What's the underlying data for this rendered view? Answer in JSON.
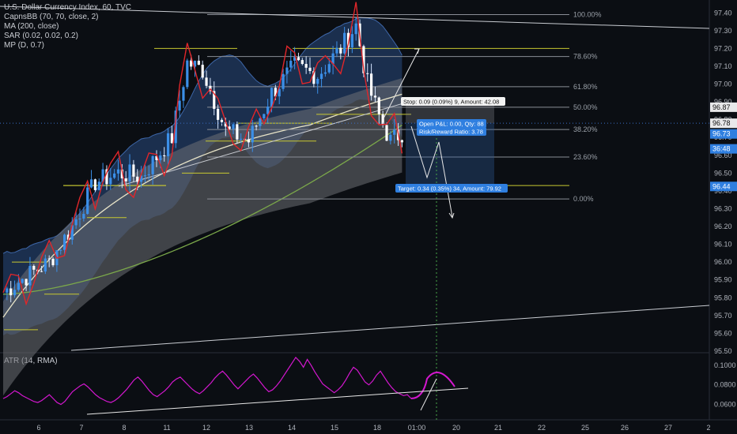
{
  "legend": {
    "title": "U.S. Dollar Currency Index, 60, TVC",
    "indicators": [
      "CapnsBB (70, 70, close, 2)",
      "MA (200, close)",
      "SAR (0.02, 0.02, 0.2)",
      "MP (D, 0.7)"
    ]
  },
  "atr_label": "ATR (14, RMA)",
  "colors": {
    "background": "#0b0e13",
    "band_blue": "#2a4a80",
    "band_grey": "#6d6f74",
    "sar_red": "#e0262a",
    "ma_green": "#7ba84a",
    "atr_magenta": "#d417cf",
    "fib_grey": "#8a8e96",
    "mp_yellow": "#c8c830",
    "price_tag_blue": "#2f7fe0"
  },
  "chart_data": {
    "type": "candlestick",
    "x_ticks": [
      "6",
      "7",
      "8",
      "11",
      "12",
      "13",
      "14",
      "15",
      "18",
      "01:00",
      "20",
      "21",
      "22",
      "25",
      "26",
      "27",
      "2"
    ],
    "y_ticks": [
      "97.40",
      "97.30",
      "97.20",
      "97.10",
      "97.00",
      "96.90",
      "96.80",
      "96.70",
      "96.60",
      "96.50",
      "96.40",
      "96.30",
      "96.20",
      "96.10",
      "96.00",
      "95.90",
      "95.80",
      "95.70",
      "95.60",
      "95.50"
    ],
    "ylim": [
      95.5,
      97.45
    ],
    "fib_levels": [
      {
        "label": "100.00%",
        "price": 97.39
      },
      {
        "label": "78.60%",
        "price": 97.155
      },
      {
        "label": "61.80%",
        "price": 96.985
      },
      {
        "label": "50.00%",
        "price": 96.87
      },
      {
        "label": "38.20%",
        "price": 96.745
      },
      {
        "label": "23.60%",
        "price": 96.59
      },
      {
        "label": "0.00%",
        "price": 96.355
      }
    ],
    "price_tags": [
      {
        "value": "96.87",
        "style": "light"
      },
      {
        "value": "96.78",
        "style": "light"
      },
      {
        "value": "96.73",
        "style": "blue"
      },
      {
        "value": "36:48",
        "style": "blue"
      },
      {
        "value": "96.44",
        "style": "blue"
      }
    ],
    "position_labels": {
      "stop": "Stop: 0.09 (0.09%) 9, Amount: 42.08",
      "open": "Open P&L: 0.00, Qty: 88",
      "ratio": "Risk/Reward Ratio: 3.78",
      "target": "Target: 0.34 (0.35%) 34, Amount: 79.92"
    },
    "atr_ticks": [
      "0.1000",
      "0.0800",
      "0.0600"
    ],
    "atr_ylim": [
      0.05,
      0.112
    ],
    "atr_values": [
      0.066,
      0.068,
      0.071,
      0.074,
      0.072,
      0.069,
      0.067,
      0.065,
      0.063,
      0.062,
      0.064,
      0.067,
      0.07,
      0.066,
      0.062,
      0.06,
      0.063,
      0.068,
      0.073,
      0.076,
      0.079,
      0.081,
      0.078,
      0.074,
      0.07,
      0.067,
      0.065,
      0.063,
      0.062,
      0.064,
      0.067,
      0.071,
      0.075,
      0.08,
      0.085,
      0.088,
      0.084,
      0.079,
      0.074,
      0.07,
      0.068,
      0.071,
      0.074,
      0.078,
      0.083,
      0.086,
      0.088,
      0.084,
      0.08,
      0.076,
      0.073,
      0.071,
      0.074,
      0.078,
      0.082,
      0.087,
      0.091,
      0.094,
      0.09,
      0.085,
      0.08,
      0.076,
      0.08,
      0.084,
      0.088,
      0.091,
      0.087,
      0.082,
      0.077,
      0.073,
      0.075,
      0.079,
      0.084,
      0.09,
      0.096,
      0.102,
      0.108,
      0.104,
      0.098,
      0.106,
      0.1,
      0.093,
      0.087,
      0.081,
      0.078,
      0.075,
      0.072,
      0.075,
      0.079,
      0.085,
      0.092,
      0.098,
      0.095,
      0.089,
      0.083,
      0.08,
      0.084,
      0.09,
      0.094,
      0.088,
      0.082,
      0.077,
      0.073,
      0.071,
      0.069,
      0.07,
      0.066
    ]
  }
}
